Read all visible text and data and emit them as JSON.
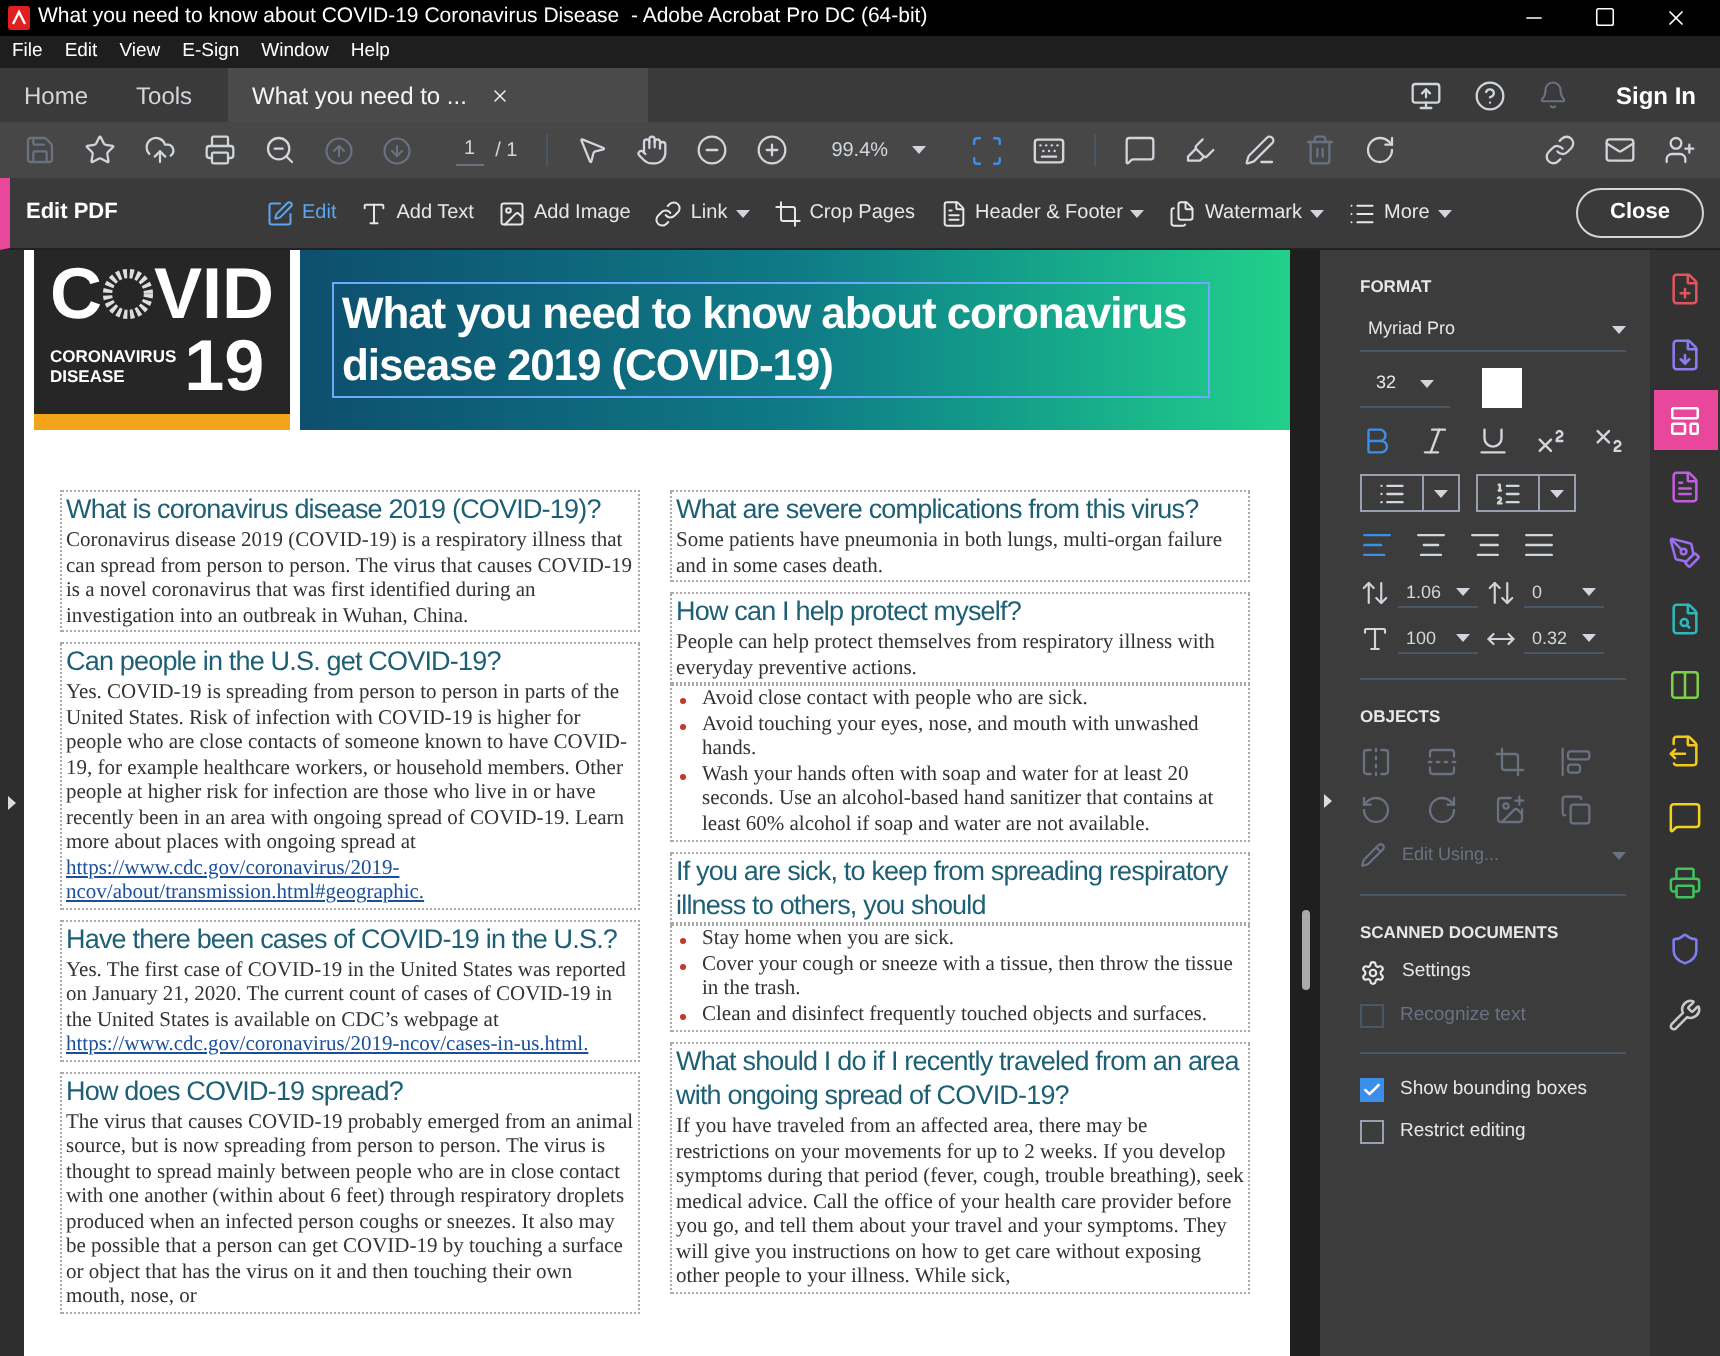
{
  "window": {
    "title": "What you need to know about COVID-19 Coronavirus Disease  - Adobe Acrobat Pro DC (64-bit)"
  },
  "menu": [
    "File",
    "Edit",
    "View",
    "E-Sign",
    "Window",
    "Help"
  ],
  "tabs": [
    {
      "label": "Home",
      "selected": false,
      "closable": false
    },
    {
      "label": "Tools",
      "selected": false,
      "closable": false
    },
    {
      "label": "What you need to ...",
      "selected": true,
      "closable": true
    }
  ],
  "sign_in": "Sign In",
  "toolbar": {
    "page_current": "1",
    "page_total": "/ 1",
    "zoom": "99.4%"
  },
  "edit_bar": {
    "title": "Edit PDF",
    "close": "Close",
    "tools": [
      {
        "kind": "edit",
        "label": "Edit",
        "selected": true,
        "dropdown": false
      },
      {
        "kind": "text",
        "label": "Add Text",
        "selected": false,
        "dropdown": false
      },
      {
        "kind": "image",
        "label": "Add Image",
        "selected": false,
        "dropdown": false
      },
      {
        "kind": "link",
        "label": "Link",
        "selected": false,
        "dropdown": true
      },
      {
        "kind": "crop",
        "label": "Crop Pages",
        "selected": false,
        "dropdown": false
      },
      {
        "kind": "header",
        "label": "Header & Footer",
        "selected": false,
        "dropdown": true
      },
      {
        "kind": "watermark",
        "label": "Watermark",
        "selected": false,
        "dropdown": true
      },
      {
        "kind": "more",
        "label": "More",
        "selected": false,
        "dropdown": true
      }
    ]
  },
  "document": {
    "logo": {
      "letter": "C",
      "letters": "VID",
      "number": "19",
      "line_1": "CORONAVIRUS",
      "line_2": "DISEASE"
    },
    "title": "What you need to know about coronavirus disease 2019 (COVID-19)",
    "columns": [
      [
        {
          "heading": "What is coronavirus disease 2019 (COVID-19)?",
          "blocks": [
            {
              "kind": "paragraph",
              "text": "Coronavirus disease 2019 (COVID-19) is a respiratory illness that can spread from person to person. The virus that causes COVID-19 is a novel coronavirus that was first identified during an investigation into an outbreak in Wuhan, China."
            }
          ]
        },
        {
          "heading": "Can people in the U.S. get COVID-19?",
          "blocks": [
            {
              "kind": "paragraph",
              "text": "Yes. COVID-19 is spreading from person to person in parts of the United States. Risk of infection with COVID-19 is higher for people who are close contacts of someone known to have COVID-19, for example healthcare workers, or household members. Other people at higher risk for infection are those who live in or have recently been in an area with ongoing spread of COVID-19. Learn more about places with ongoing spread at",
              "link": "https://www.cdc.gov/coronavirus/2019-ncov/about/transmission.html#geographic."
            }
          ]
        },
        {
          "heading": "Have there been cases of COVID-19 in the U.S.?",
          "blocks": [
            {
              "kind": "paragraph",
              "text": "Yes. The first case of COVID-19 in the United States was reported on January 21, 2020. The current count of cases of COVID-19 in the United States is available on CDC’s webpage at",
              "link": "https://www.cdc.gov/coronavirus/2019-ncov/cases-in-us.html."
            }
          ]
        },
        {
          "heading": "How does COVID-19 spread?",
          "blocks": [
            {
              "kind": "paragraph",
              "text": "The virus that causes COVID-19 probably emerged from an animal source, but is now spreading from person to person. The virus is thought to spread mainly between people who are in close contact with one another (within about 6 feet) through respiratory droplets produced when an infected person coughs or sneezes. It also may be possible that a person can get COVID-19 by touching a surface or object that has the virus on it and then touching their own mouth, nose, or"
            }
          ]
        }
      ],
      [
        {
          "heading": "What are severe complications from this virus?",
          "blocks": [
            {
              "kind": "paragraph",
              "text": "Some patients have pneumonia in both lungs, multi-organ failure and in some cases death."
            }
          ]
        },
        {
          "heading": "How can I help protect myself?",
          "blocks": [
            {
              "kind": "paragraph",
              "text": "People can help protect themselves from respiratory illness with everyday preventive actions."
            },
            {
              "kind": "bullets",
              "items": [
                "Avoid close contact with people who are sick.",
                "Avoid touching your eyes, nose, and mouth with unwashed hands.",
                "Wash your hands often with soap and water for at least 20 seconds. Use an alcohol-based hand sanitizer that contains at least 60% alcohol if soap and water are not available."
              ]
            }
          ]
        },
        {
          "heading": "If you are sick, to keep from spreading respiratory illness to others, you should",
          "blocks": [
            {
              "kind": "bullets",
              "items": [
                "Stay home when you are sick.",
                "Cover your cough or sneeze with a tissue, then throw the tissue in the trash.",
                "Clean and disinfect frequently touched objects and surfaces."
              ]
            }
          ]
        },
        {
          "heading": "What should I do if I recently traveled from an area with ongoing spread of COVID-19?",
          "blocks": [
            {
              "kind": "paragraph",
              "text": "If you have traveled from an affected area, there may be restrictions on your movements for up to 2 weeks. If you develop symptoms during that period (fever, cough, trouble breathing), seek medical advice. Call the office of your health care provider before you go, and tell them about your travel and your symptoms. They will give you instructions on how to get care without exposing other people to your illness. While sick,"
            }
          ]
        }
      ]
    ]
  },
  "format": {
    "heading": "FORMAT",
    "font": "Myriad Pro",
    "size": "32",
    "text_styles": [
      {
        "kind": "bold",
        "selected": true
      },
      {
        "kind": "italic",
        "selected": false
      },
      {
        "kind": "underline",
        "selected": false
      },
      {
        "kind": "superscript",
        "selected": false
      },
      {
        "kind": "subscript",
        "selected": false
      }
    ],
    "alignments": [
      {
        "kind": "left",
        "selected": true
      },
      {
        "kind": "center",
        "selected": false
      },
      {
        "kind": "right",
        "selected": false
      },
      {
        "kind": "justify",
        "selected": false
      }
    ],
    "line_spacing": "1.06",
    "paragraph_spacing": "0",
    "horizontal_scale": "100",
    "character_spacing": "0.32"
  },
  "objects": {
    "heading": "OBJECTS",
    "edit_using": "Edit Using...",
    "disabled": true
  },
  "scanned": {
    "heading": "SCANNED DOCUMENTS",
    "settings": "Settings",
    "options": [
      {
        "label": "Recognize text",
        "checked": false,
        "disabled": true
      },
      {
        "label": "Show bounding boxes",
        "checked": true,
        "disabled": false
      },
      {
        "label": "Restrict editing",
        "checked": false,
        "disabled": false
      }
    ]
  },
  "tool_rail": [
    {
      "kind": "create",
      "color": "#e0555f",
      "selected": false
    },
    {
      "kind": "export",
      "color": "#8a7df0",
      "selected": false
    },
    {
      "kind": "edit",
      "color": "#e8479b",
      "selected": true
    },
    {
      "kind": "form",
      "color": "#c15ee0",
      "selected": false
    },
    {
      "kind": "sign",
      "color": "#9b6ef0",
      "selected": false
    },
    {
      "kind": "send",
      "color": "#2fb8b8",
      "selected": false
    },
    {
      "kind": "organize",
      "color": "#7ed04a",
      "selected": false
    },
    {
      "kind": "compress",
      "color": "#f2c81d",
      "selected": false
    },
    {
      "kind": "comment",
      "color": "#f2d21d",
      "selected": false
    },
    {
      "kind": "print",
      "color": "#3fc35a",
      "selected": false
    },
    {
      "kind": "protect",
      "color": "#7e7ef0",
      "selected": false
    },
    {
      "kind": "tools",
      "color": "#c8c8c8",
      "selected": false
    }
  ]
}
